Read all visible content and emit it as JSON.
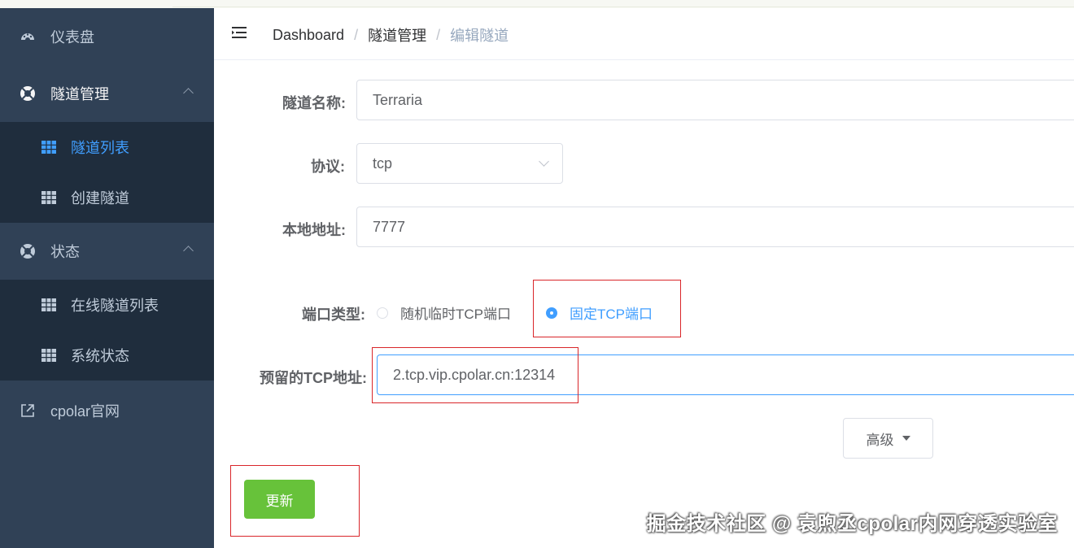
{
  "sidebar": {
    "items": [
      {
        "label": "仪表盘",
        "icon": "dashboard-icon"
      },
      {
        "label": "隧道管理",
        "icon": "lifebuoy-icon"
      },
      {
        "label": "隧道列表",
        "icon": "grid-icon"
      },
      {
        "label": "创建隧道",
        "icon": "grid-icon"
      },
      {
        "label": "状态",
        "icon": "lifebuoy-icon"
      },
      {
        "label": "在线隧道列表",
        "icon": "grid-icon"
      },
      {
        "label": "系统状态",
        "icon": "grid-icon"
      },
      {
        "label": "cpolar官网",
        "icon": "external-link-icon"
      }
    ]
  },
  "breadcrumb": {
    "home": "Dashboard",
    "section": "隧道管理",
    "current": "编辑隧道",
    "separator": "/"
  },
  "form": {
    "name_label": "隧道名称:",
    "name_value": "Terraria",
    "protocol_label": "协议:",
    "protocol_value": "tcp",
    "local_label": "本地地址:",
    "local_value": "7777",
    "port_type_label": "端口类型:",
    "port_option_random": "随机临时TCP端口",
    "port_option_fixed": "固定TCP端口",
    "reserved_label": "预留的TCP地址:",
    "reserved_value": "2.tcp.vip.cpolar.cn:12314",
    "advanced_label": "高级",
    "update_label": "更新"
  },
  "watermark": "掘金技术社区 @ 袁煦丞cpolar内网穿透实验室",
  "colors": {
    "sidebar_bg": "#304156",
    "submenu_bg": "#1f2d3d",
    "active": "#409eff",
    "update_button": "#67c23a",
    "highlight": "#d9262a"
  }
}
